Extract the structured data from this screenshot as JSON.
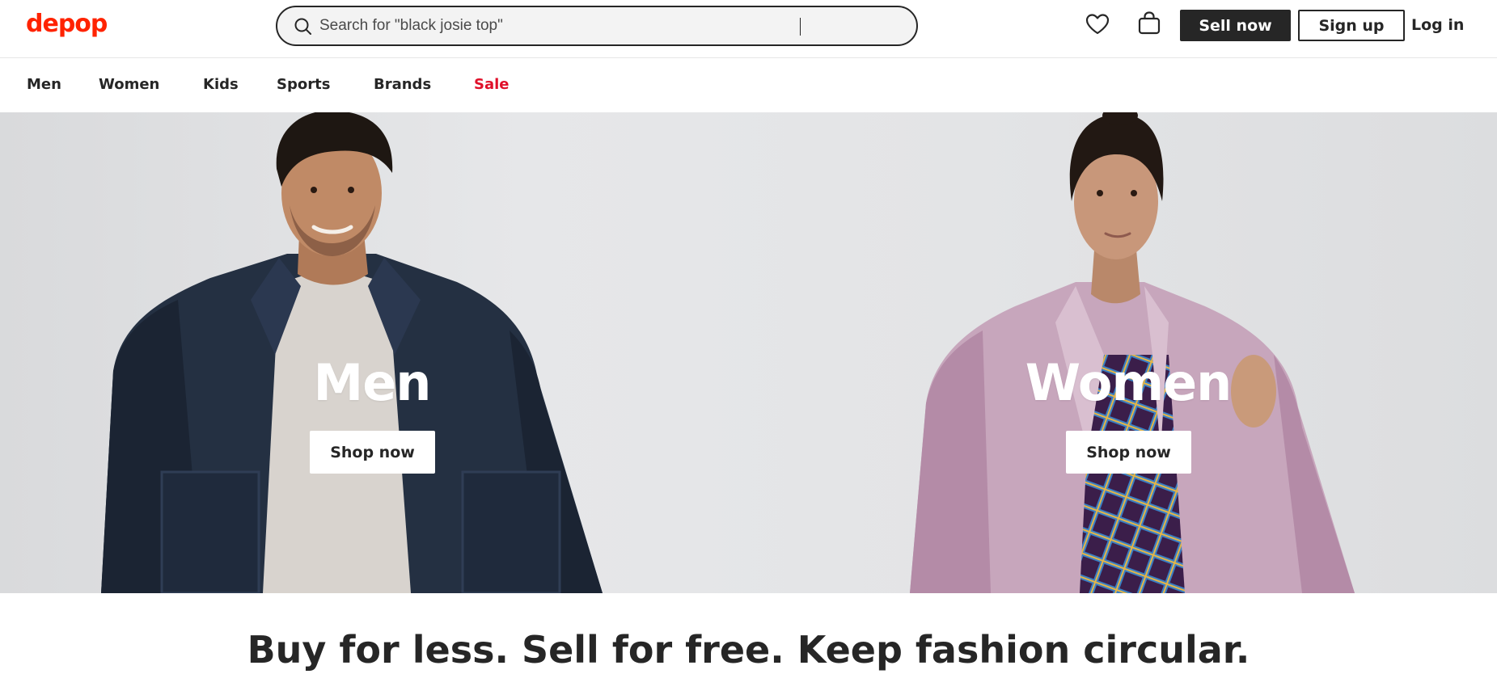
{
  "header": {
    "logo": "depop",
    "search": {
      "placeholder": "Search for \"black josie top\""
    },
    "icons": {
      "wishlist": "heart-icon",
      "bag": "bag-icon",
      "search": "search-icon"
    },
    "sell_label": "Sell now",
    "signup_label": "Sign up",
    "login_label": "Log in"
  },
  "nav": {
    "items": [
      {
        "label": "Men"
      },
      {
        "label": "Women"
      },
      {
        "label": "Kids"
      },
      {
        "label": "Sports"
      },
      {
        "label": "Brands"
      },
      {
        "label": "Sale"
      }
    ]
  },
  "hero": {
    "panels": [
      {
        "title": "Men",
        "cta": "Shop now"
      },
      {
        "title": "Women",
        "cta": "Shop now"
      }
    ]
  },
  "tagline": "Buy for less. Sell for free. Keep fashion circular.",
  "colors": {
    "brand": "#ff2300",
    "sale": "#e0102a",
    "dark": "#262626"
  }
}
